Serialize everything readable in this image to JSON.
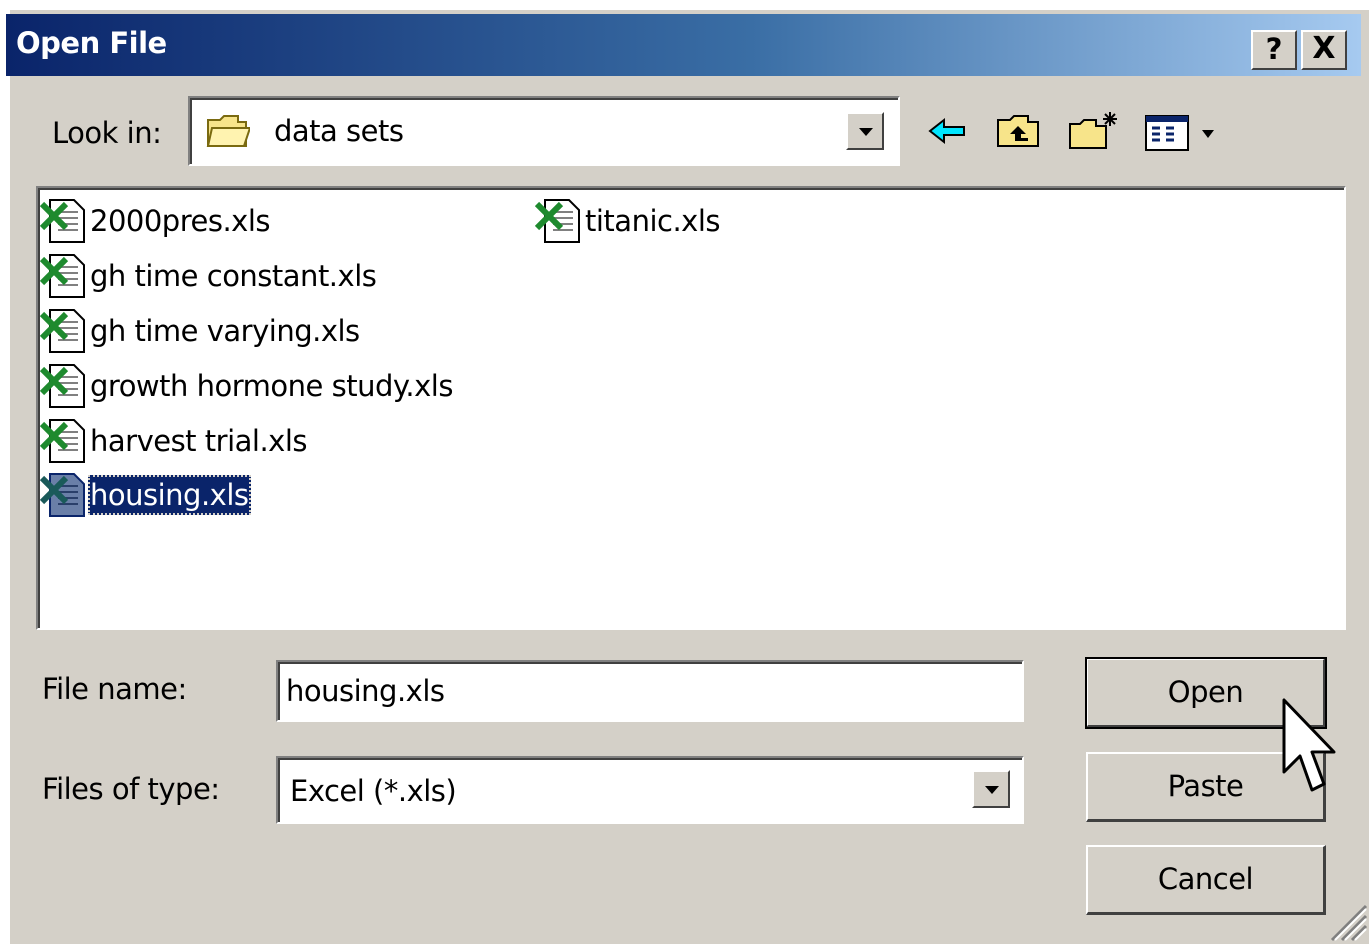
{
  "window": {
    "title": "Open File",
    "help_button": "?",
    "close_button": "X"
  },
  "look_in": {
    "label": "Look in:",
    "value": "data sets",
    "icon": "folder-icon"
  },
  "toolbar": {
    "icons": [
      "back-arrow-icon",
      "up-one-level-icon",
      "create-new-folder-icon",
      "view-menu-icon"
    ]
  },
  "files": [
    {
      "name": "2000pres.xls",
      "icon": "excel-file-icon",
      "selected": false
    },
    {
      "name": "gh time constant.xls",
      "icon": "excel-file-icon",
      "selected": false
    },
    {
      "name": "gh time varying.xls",
      "icon": "excel-file-icon",
      "selected": false
    },
    {
      "name": "growth hormone study.xls",
      "icon": "excel-file-icon",
      "selected": false
    },
    {
      "name": "harvest trial.xls",
      "icon": "excel-file-icon",
      "selected": false
    },
    {
      "name": "housing.xls",
      "icon": "excel-file-icon",
      "selected": true
    },
    {
      "name": "titanic.xls",
      "icon": "excel-file-icon",
      "selected": false
    }
  ],
  "file_name": {
    "label": "File name:",
    "value": "housing.xls"
  },
  "files_of_type": {
    "label": "Files of type:",
    "value": "Excel (*.xls)"
  },
  "buttons": {
    "open": "Open",
    "paste": "Paste",
    "cancel": "Cancel"
  },
  "colors": {
    "title_start": "#0a246a",
    "title_end": "#a6caf0",
    "selection": "#0a246a",
    "face": "#d4d0c8"
  }
}
